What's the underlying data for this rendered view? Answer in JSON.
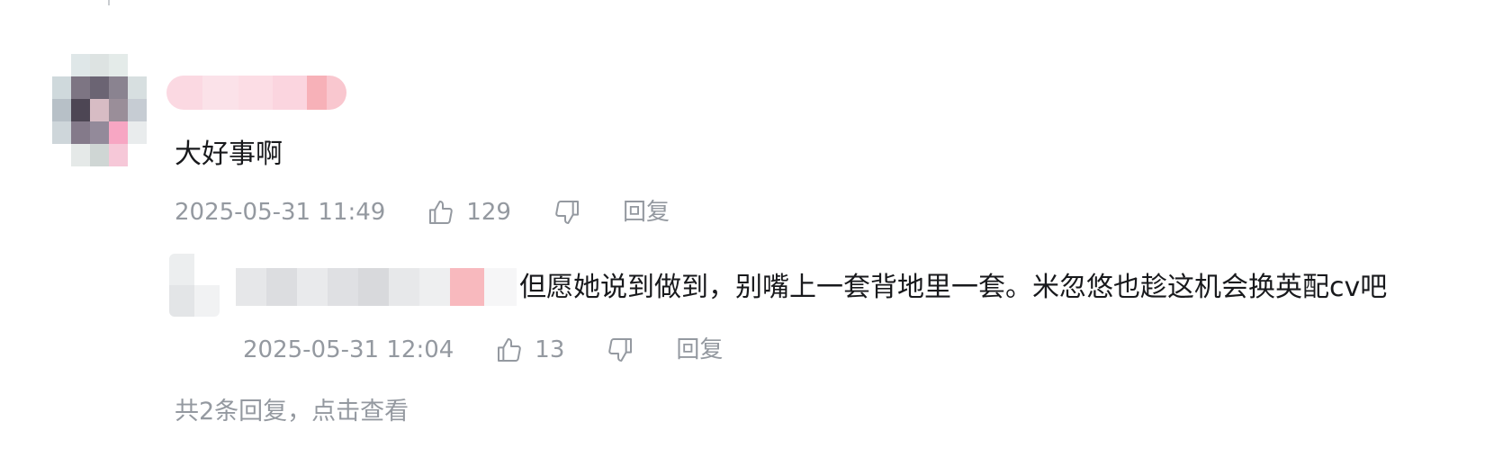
{
  "comment": {
    "text": "大好事啊",
    "time": "2025-05-31 11:49",
    "likes": "129",
    "reply_label": "回复"
  },
  "sub_reply": {
    "text": "但愿她说到做到，别嘴上一套背地里一套。米忽悠也趁这机会换英配cv吧",
    "time": "2025-05-31 12:04",
    "likes": "13",
    "reply_label": "回复"
  },
  "view_replies_label": "共2条回复，点击查看",
  "icons": {
    "like": "thumbs-up-icon",
    "dislike": "thumbs-down-icon"
  },
  "colors": {
    "meta_text": "#9499a0",
    "body_text": "#18191c",
    "icon_stroke": "#9499a0"
  }
}
